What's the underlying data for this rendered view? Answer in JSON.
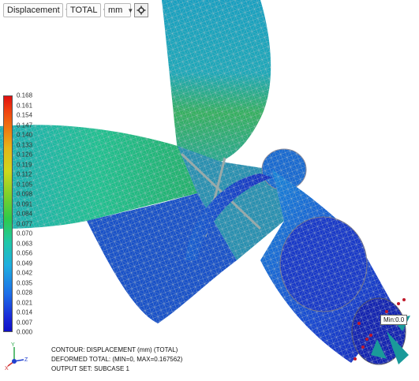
{
  "toolbar": {
    "result_type": "Displacement",
    "component": "TOTAL",
    "unit": "mm",
    "settings_icon": "gear-icon"
  },
  "legend": {
    "labels": [
      "0.168",
      "0.161",
      "0.154",
      "0.147",
      "0.140",
      "0.133",
      "0.126",
      "0.119",
      "0.112",
      "0.105",
      "0.098",
      "0.091",
      "0.084",
      "0.077",
      "0.070",
      "0.063",
      "0.056",
      "0.049",
      "0.042",
      "0.035",
      "0.028",
      "0.021",
      "0.014",
      "0.007",
      "0.000"
    ],
    "colors": [
      "#e01010",
      "#1010c8"
    ]
  },
  "info": {
    "contour": "CONTOUR: DISPLACEMENT (mm) (TOTAL)",
    "deformed": "DEFORMED TOTAL: (MIN=0, MAX=0.167562)",
    "output_set": "OUTPUT SET: SUBCASE 1"
  },
  "min_label": "Min:0.0",
  "axes": {
    "y": "Y",
    "x": "X",
    "z": "Z"
  }
}
